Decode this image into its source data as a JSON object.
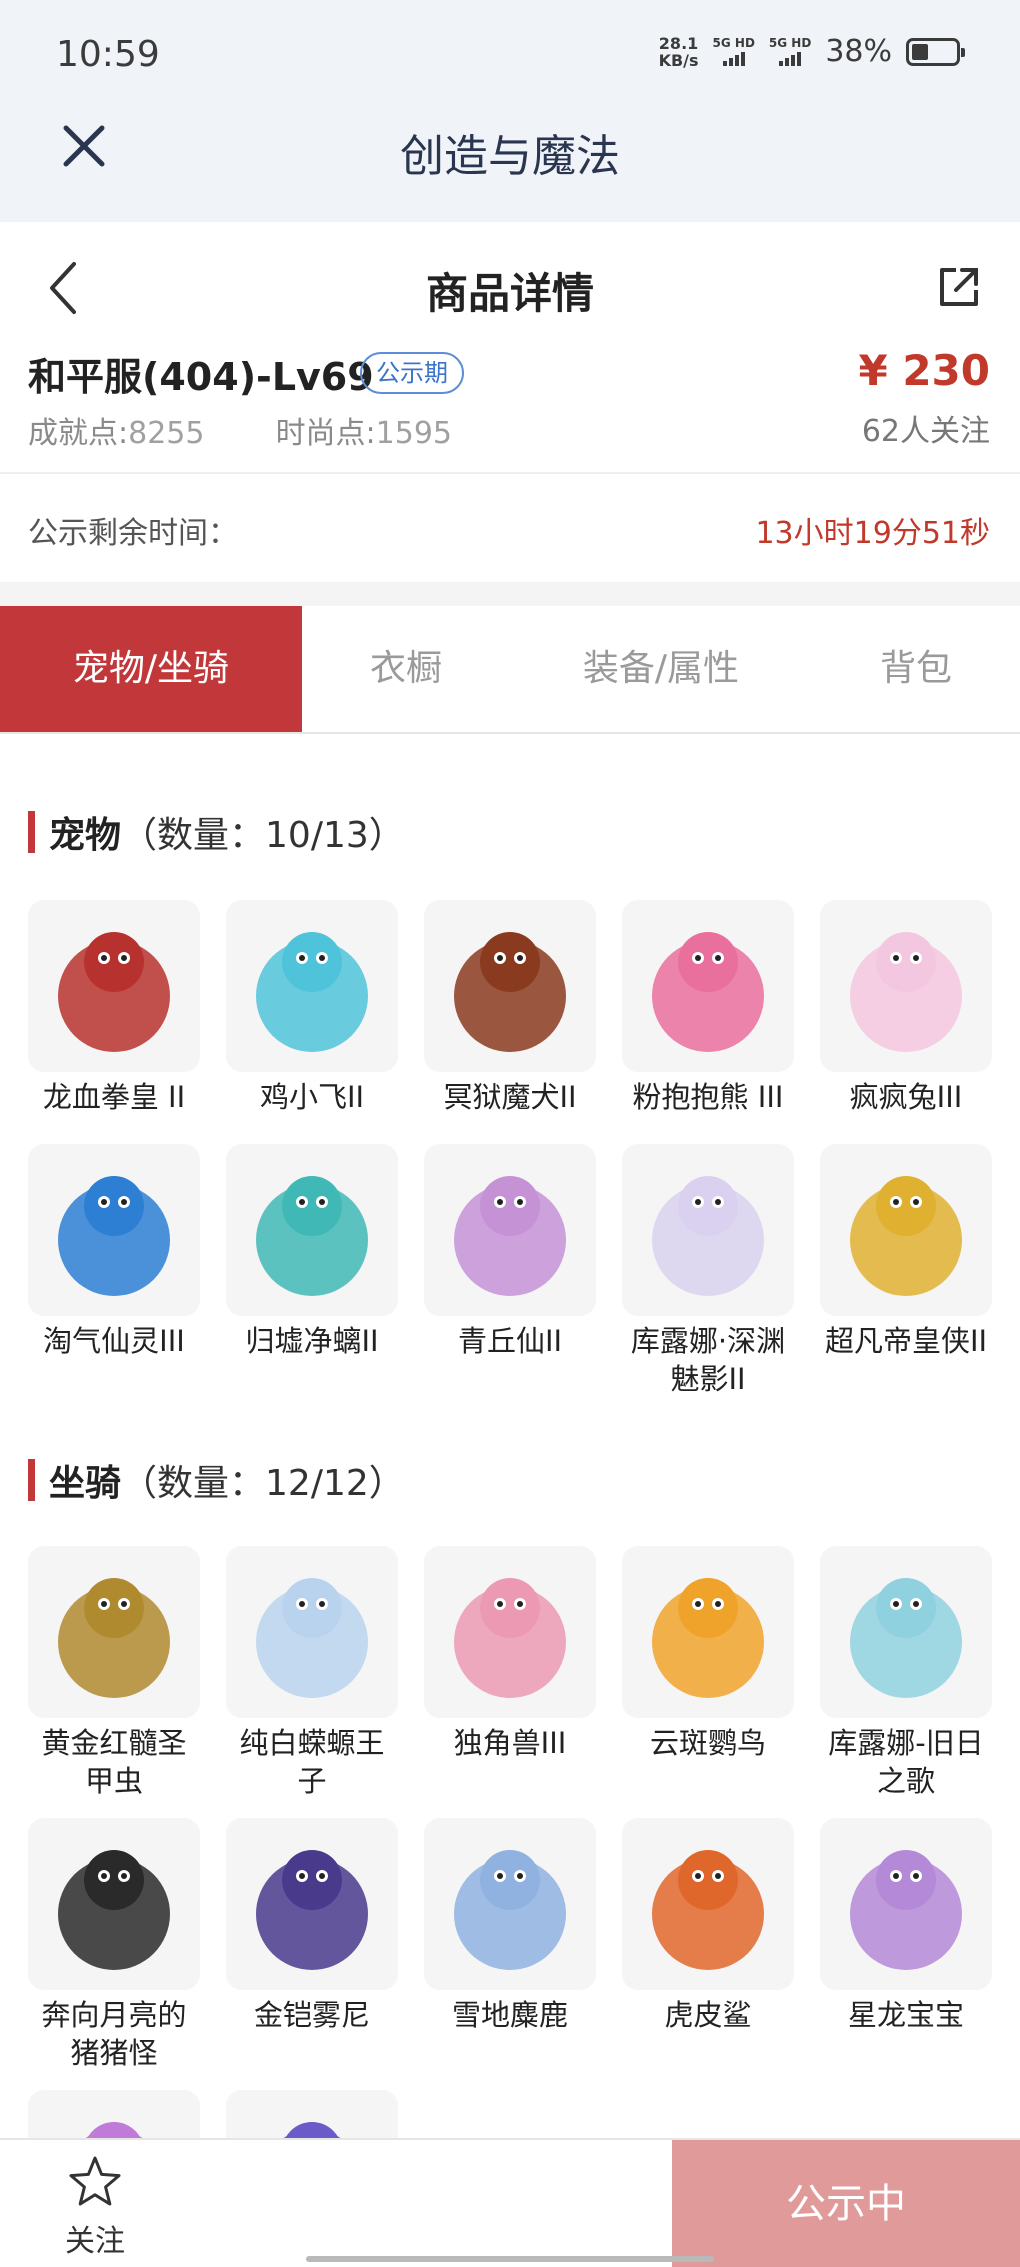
{
  "status_bar": {
    "time": "10:59",
    "net_speed_value": "28.1",
    "net_speed_unit": "KB/s",
    "sim1": "5G HD",
    "sim2": "5G HD",
    "battery_percent": "38%",
    "battery_level": 0.38
  },
  "app_bar": {
    "title": "创造与魔法",
    "close_icon": "close-icon"
  },
  "page_header": {
    "title": "商品详情",
    "back_icon": "chevron-left-icon",
    "share_icon": "share-icon"
  },
  "account": {
    "name": "和平服(404)-Lv69",
    "badge": "公示期",
    "achievement_label": "成就点:",
    "achievement_value": "8255",
    "fashion_label": "时尚点:",
    "fashion_value": "1595",
    "price": "¥ 230",
    "followers": "62人关注"
  },
  "countdown": {
    "label": "公示剩余时间：",
    "value": "13小时19分51秒"
  },
  "tabs": [
    {
      "label": "宠物/坐骑",
      "active": true
    },
    {
      "label": "衣橱",
      "active": false
    },
    {
      "label": "装备/属性",
      "active": false
    },
    {
      "label": "背包",
      "active": false
    }
  ],
  "pets": {
    "name": "宠物",
    "count": "（数量：10/13）",
    "items": [
      {
        "label": "龙血拳皇 II",
        "color": "#b7322f"
      },
      {
        "label": "鸡小飞II",
        "color": "#4fc3d9"
      },
      {
        "label": "冥狱魔犬II",
        "color": "#8a3a1f"
      },
      {
        "label": "粉抱抱熊 III",
        "color": "#e96f9d"
      },
      {
        "label": "疯疯兔III",
        "color": "#f4c7e0"
      },
      {
        "label": "淘气仙灵III",
        "color": "#2d7fd3"
      },
      {
        "label": "归墟净螭II",
        "color": "#3fb8b6"
      },
      {
        "label": "青丘仙II",
        "color": "#c592d6"
      },
      {
        "label": "库露娜·深渊魅影II",
        "color": "#d9d1ef"
      },
      {
        "label": "超凡帝皇侠II",
        "color": "#e0b030"
      }
    ]
  },
  "mounts": {
    "name": "坐骑",
    "count": "（数量：12/12）",
    "items": [
      {
        "label": "黄金红髓圣甲虫",
        "color": "#b08a2f"
      },
      {
        "label": "纯白蝾螈王子",
        "color": "#b9d3ef"
      },
      {
        "label": "独角兽III",
        "color": "#ec9ab4"
      },
      {
        "label": "云斑鹦鸟",
        "color": "#f0a32a"
      },
      {
        "label": "库露娜-旧日之歌",
        "color": "#8fd1de"
      },
      {
        "label": "奔向月亮的猪猪怪",
        "color": "#2a2a2a"
      },
      {
        "label": "金铠雾尼",
        "color": "#4a3a8c"
      },
      {
        "label": "雪地麋鹿",
        "color": "#8fb2e0"
      },
      {
        "label": "虎皮鲨",
        "color": "#e0672c"
      },
      {
        "label": "星龙宝宝",
        "color": "#b48ad8"
      },
      {
        "label": "",
        "color": "#c07ad8"
      },
      {
        "label": "",
        "color": "#6a5bc9"
      }
    ]
  },
  "bottom_bar": {
    "follow_label": "关注",
    "status_label": "公示中"
  }
}
